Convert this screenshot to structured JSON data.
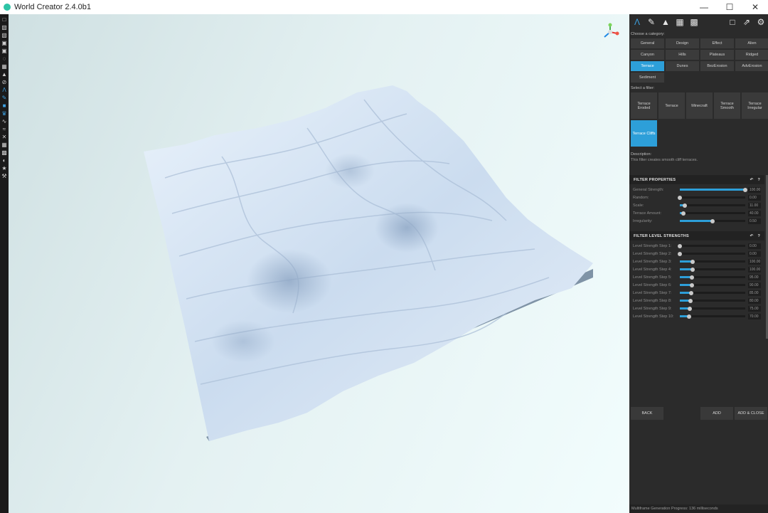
{
  "window": {
    "title": "World Creator 2.4.0b1"
  },
  "panel": {
    "choose_category_label": "Choose a category:",
    "categories": [
      {
        "label": "General"
      },
      {
        "label": "Design"
      },
      {
        "label": "Effect"
      },
      {
        "label": "Alien"
      },
      {
        "label": "Canyon"
      },
      {
        "label": "Hills"
      },
      {
        "label": "Plateaus"
      },
      {
        "label": "Ridged"
      },
      {
        "label": "Terrace"
      },
      {
        "label": "Dunes"
      },
      {
        "label": "BezErosion"
      },
      {
        "label": "AdvErosion"
      },
      {
        "label": "Sediment"
      }
    ],
    "active_category": "Terrace",
    "select_filter_label": "Select a filter:",
    "filters": [
      {
        "label": "Terrace Eroded"
      },
      {
        "label": "Terrace"
      },
      {
        "label": "Minecraft"
      },
      {
        "label": "Terrace Smooth"
      },
      {
        "label": "Terrace Irregular"
      },
      {
        "label": "Terrace Cliffs"
      }
    ],
    "active_filter": "Terrace Cliffs",
    "description_label": "Description:",
    "description_text": "This filter creates smooth cliff terraces.",
    "filter_properties": {
      "title": "FILTER PROPERTIES",
      "rows": [
        {
          "label": "General Strength:",
          "value": "100.00",
          "level": 1.0
        },
        {
          "label": "Random:",
          "value": "0.00",
          "level": 0.0
        },
        {
          "label": "Scale:",
          "value": "11.00",
          "level": 0.08
        },
        {
          "label": "Terrace Amount:",
          "value": "40.00",
          "level": 0.05
        },
        {
          "label": "Irregularity:",
          "value": "0.50",
          "level": 0.5
        }
      ]
    },
    "filter_levels": {
      "title": "FILTER LEVEL STRENGTHS",
      "rows": [
        {
          "label": "Level Strength Step 1:",
          "value": "0.00",
          "level": 0.0
        },
        {
          "label": "Level Strength Step 2:",
          "value": "0.00",
          "level": 0.0
        },
        {
          "label": "Level Strength Step 3:",
          "value": "100.00",
          "level": 0.2
        },
        {
          "label": "Level Strength Step 4:",
          "value": "100.00",
          "level": 0.2
        },
        {
          "label": "Level Strength Step 5:",
          "value": "95.00",
          "level": 0.19
        },
        {
          "label": "Level Strength Step 6:",
          "value": "90.00",
          "level": 0.18
        },
        {
          "label": "Level Strength Step 7:",
          "value": "85.00",
          "level": 0.17
        },
        {
          "label": "Level Strength Step 8:",
          "value": "80.00",
          "level": 0.16
        },
        {
          "label": "Level Strength Step 9:",
          "value": "75.00",
          "level": 0.15
        },
        {
          "label": "Level Strength Step 10:",
          "value": "70.00",
          "level": 0.14
        }
      ]
    },
    "buttons": {
      "back": "BACK",
      "add": "ADD",
      "add_close": "ADD & CLOSE"
    },
    "status": "Multiframe Generation Progress: 136 milliseconds"
  },
  "colors": {
    "accent": "#2d9fd9",
    "panel_bg": "#2b2b2b",
    "toolbar_bg": "#1b1b1b"
  }
}
